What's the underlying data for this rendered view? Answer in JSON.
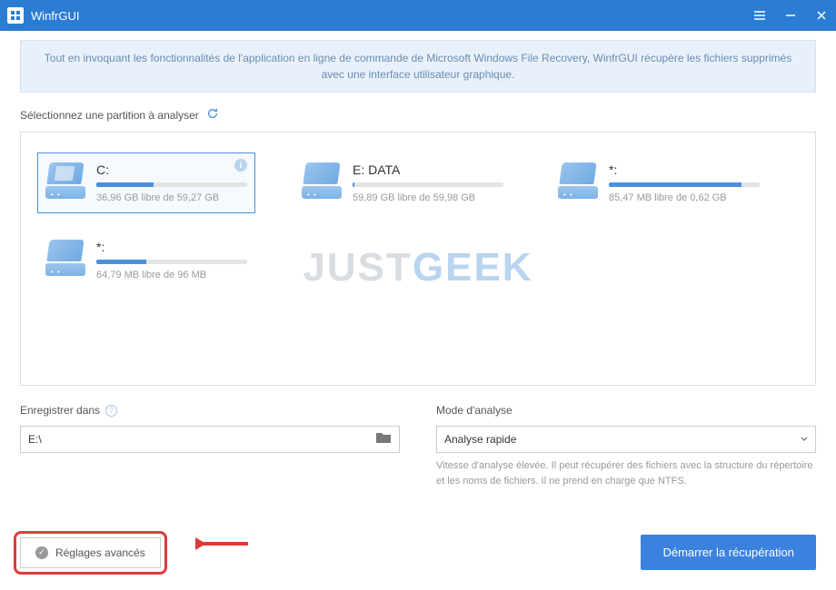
{
  "app": {
    "title": "WinfrGUI"
  },
  "banner": "Tout en invoquant les fonctionnalités de l'application en ligne de commande de Microsoft Windows File Recovery, WinfrGUI récupère les fichiers supprimés avec une interface utilisateur graphique.",
  "select_label": "Sélectionnez une partition à analyser",
  "partitions": [
    {
      "name": "C:",
      "free": "36,96 GB libre de 59,27 GB",
      "used_pct": 38,
      "selected": true,
      "windows": true
    },
    {
      "name": "E: DATA",
      "free": "59,89 GB libre de 59,98 GB",
      "used_pct": 1,
      "selected": false,
      "windows": false
    },
    {
      "name": "*:",
      "free": "85,47 MB libre de 0,62 GB",
      "used_pct": 88,
      "selected": false,
      "windows": false
    },
    {
      "name": "*:",
      "free": "64,79 MB libre de 96 MB",
      "used_pct": 33,
      "selected": false,
      "windows": false
    }
  ],
  "watermark": {
    "a": "JUST",
    "b": "GEEK"
  },
  "save": {
    "label": "Enregistrer dans",
    "path": "E:\\"
  },
  "mode": {
    "label": "Mode d'analyse",
    "selected": "Analyse rapide",
    "desc": "Vitesse d'analyse élevée. Il peut récupérer des fichiers avec la structure du répertoire et les noms de fichiers. Il ne prend en charge que NTFS."
  },
  "buttons": {
    "advanced": "Réglages avancés",
    "start": "Démarrer la récupération"
  }
}
